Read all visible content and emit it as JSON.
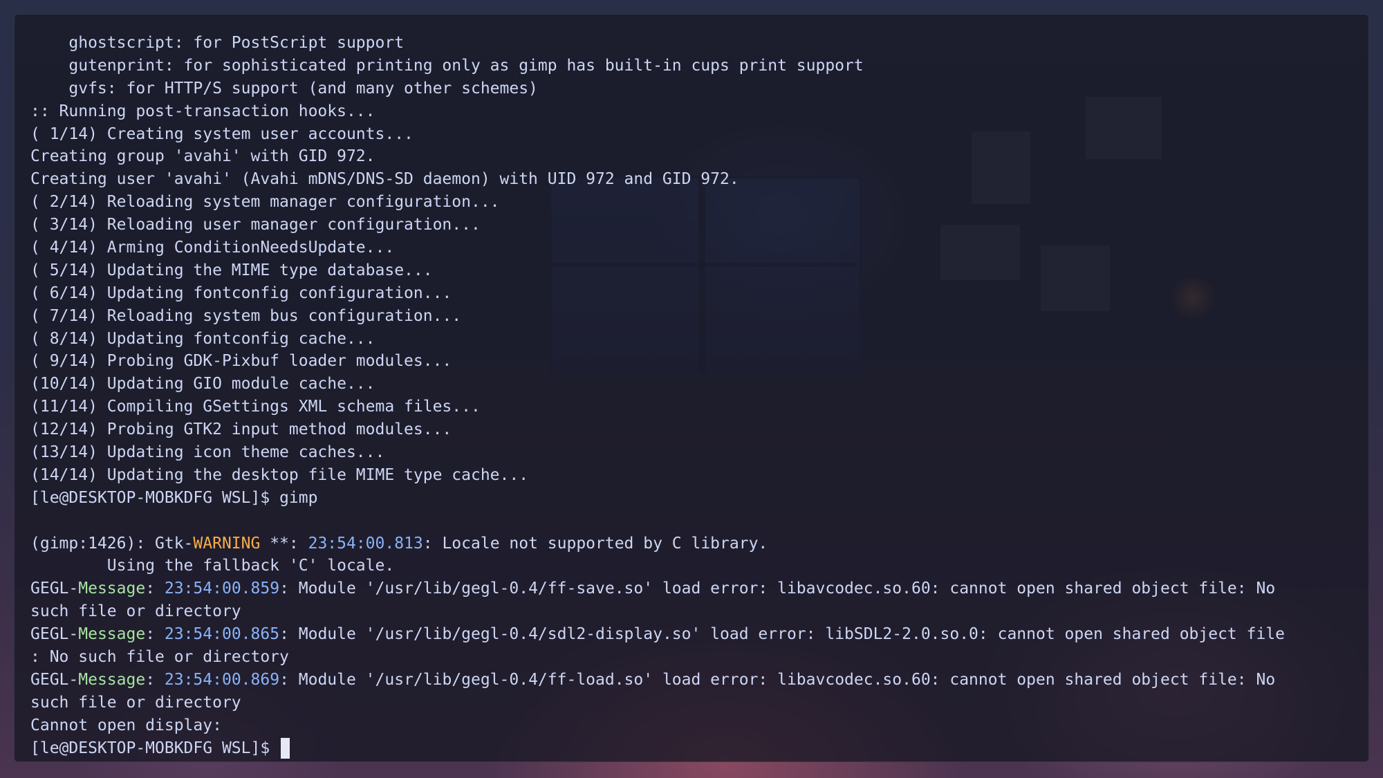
{
  "terminal": {
    "lines": [
      "    ghostscript: for PostScript support",
      "    gutenprint: for sophisticated printing only as gimp has built-in cups print support",
      "    gvfs: for HTTP/S support (and many other schemes)",
      ":: Running post-transaction hooks...",
      "( 1/14) Creating system user accounts...",
      "Creating group 'avahi' with GID 972.",
      "Creating user 'avahi' (Avahi mDNS/DNS-SD daemon) with UID 972 and GID 972.",
      "( 2/14) Reloading system manager configuration...",
      "( 3/14) Reloading user manager configuration...",
      "( 4/14) Arming ConditionNeedsUpdate...",
      "( 5/14) Updating the MIME type database...",
      "( 6/14) Updating fontconfig configuration...",
      "( 7/14) Reloading system bus configuration...",
      "( 8/14) Updating fontconfig cache...",
      "( 9/14) Probing GDK-Pixbuf loader modules...",
      "(10/14) Updating GIO module cache...",
      "(11/14) Compiling GSettings XML schema files...",
      "(12/14) Probing GTK2 input method modules...",
      "(13/14) Updating icon theme caches...",
      "(14/14) Updating the desktop file MIME type cache...",
      "[le@DESKTOP-MOBKDFG WSL]$ gimp",
      ""
    ],
    "warning_line": {
      "prefix": "(gimp:1426): Gtk-",
      "level": "WARNING",
      "stars": " **: ",
      "timestamp": "23:54:00.813",
      "text": ": Locale not supported by C library."
    },
    "fallback_line": "        Using the fallback 'C' locale.",
    "gegl_messages": [
      {
        "prefix": "GEGL-",
        "level": "Message",
        "sep": ": ",
        "timestamp": "23:54:00.859",
        "text": ": Module '/usr/lib/gegl-0.4/ff-save.so' load error: libavcodec.so.60: cannot open shared object file: No",
        "continuation": "such file or directory"
      },
      {
        "prefix": "GEGL-",
        "level": "Message",
        "sep": ": ",
        "timestamp": "23:54:00.865",
        "text": ": Module '/usr/lib/gegl-0.4/sdl2-display.so' load error: libSDL2-2.0.so.0: cannot open shared object file",
        "continuation": ": No such file or directory"
      },
      {
        "prefix": "GEGL-",
        "level": "Message",
        "sep": ": ",
        "timestamp": "23:54:00.869",
        "text": ": Module '/usr/lib/gegl-0.4/ff-load.so' load error: libavcodec.so.60: cannot open shared object file: No",
        "continuation": "such file or directory"
      }
    ],
    "display_error": "Cannot open display:",
    "prompt": "[le@DESKTOP-MOBKDFG WSL]$ ",
    "colors": {
      "text": "#cdd6f4",
      "warning": "#f9ad4a",
      "message": "#a6e3a1",
      "timestamp": "#89b4fa",
      "background": "#181825"
    }
  }
}
